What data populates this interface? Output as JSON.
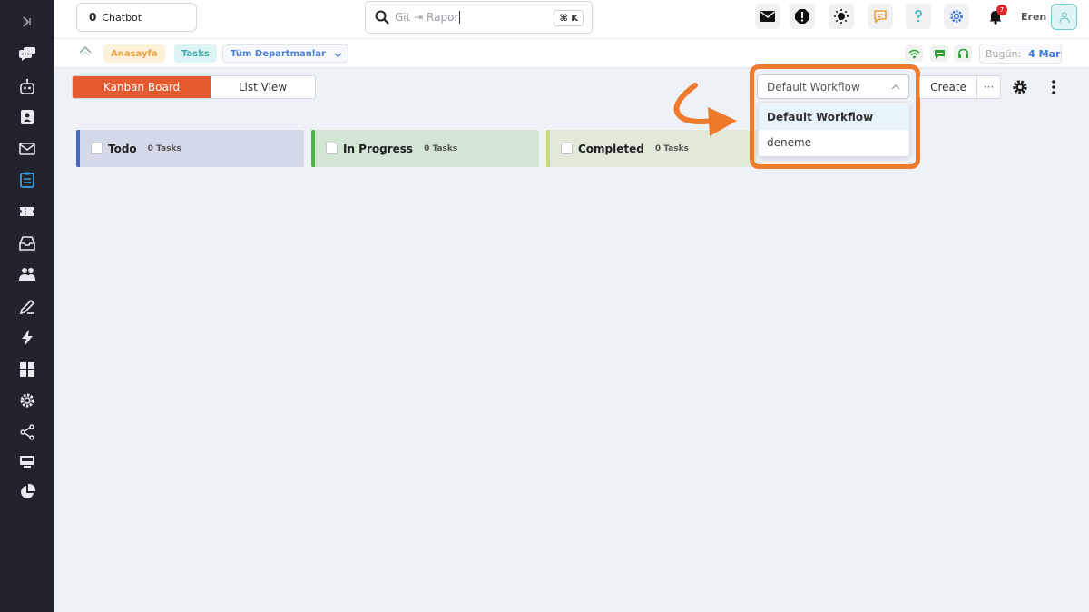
{
  "sidebar": {
    "items": [
      {
        "icon": "chevron-right-icon"
      },
      {
        "icon": "chat-bubbles-icon"
      },
      {
        "icon": "robot-icon"
      },
      {
        "icon": "contact-card-icon"
      },
      {
        "icon": "mail-icon"
      },
      {
        "icon": "clipboard-icon"
      },
      {
        "icon": "ticket-icon"
      },
      {
        "icon": "inbox-icon"
      },
      {
        "icon": "users-icon"
      },
      {
        "icon": "pencil-icon"
      },
      {
        "icon": "lightning-icon"
      },
      {
        "icon": "grid-icon"
      },
      {
        "icon": "cog-icon"
      },
      {
        "icon": "share-icon"
      },
      {
        "icon": "monitor-icon"
      },
      {
        "icon": "pie-chart-icon"
      }
    ]
  },
  "topbar": {
    "chatbot_count": "0",
    "chatbot_label": "Chatbot",
    "search_placeholder": "Git ⇥ Rapor",
    "search_shortcut": "⌘ K",
    "notification_count": "7",
    "username": "Eren"
  },
  "breadcrumb": {
    "home": "Anasayfa",
    "tasks": "Tasks",
    "department": "Tüm Departmanlar",
    "today_label": "Bugün:",
    "today_value": "4 Mar"
  },
  "toolbar": {
    "view_kanban": "Kanban Board",
    "view_list": "List View",
    "workflow_selected": "Default Workflow",
    "workflow_options": [
      "Default Workflow",
      "deneme"
    ],
    "create_label": "Create",
    "more_label": "···"
  },
  "board": {
    "columns": [
      {
        "name": "Todo",
        "count": "0 Tasks",
        "color": "#4467c5"
      },
      {
        "name": "In Progress",
        "count": "0 Tasks",
        "color": "#4fb34a"
      },
      {
        "name": "Completed",
        "count": "0 Tasks",
        "color": "#c2dc7a"
      }
    ]
  },
  "colors": {
    "accent": "#e35a2f",
    "highlight": "#ef7a2c",
    "sidebar_bg": "#23232e"
  }
}
